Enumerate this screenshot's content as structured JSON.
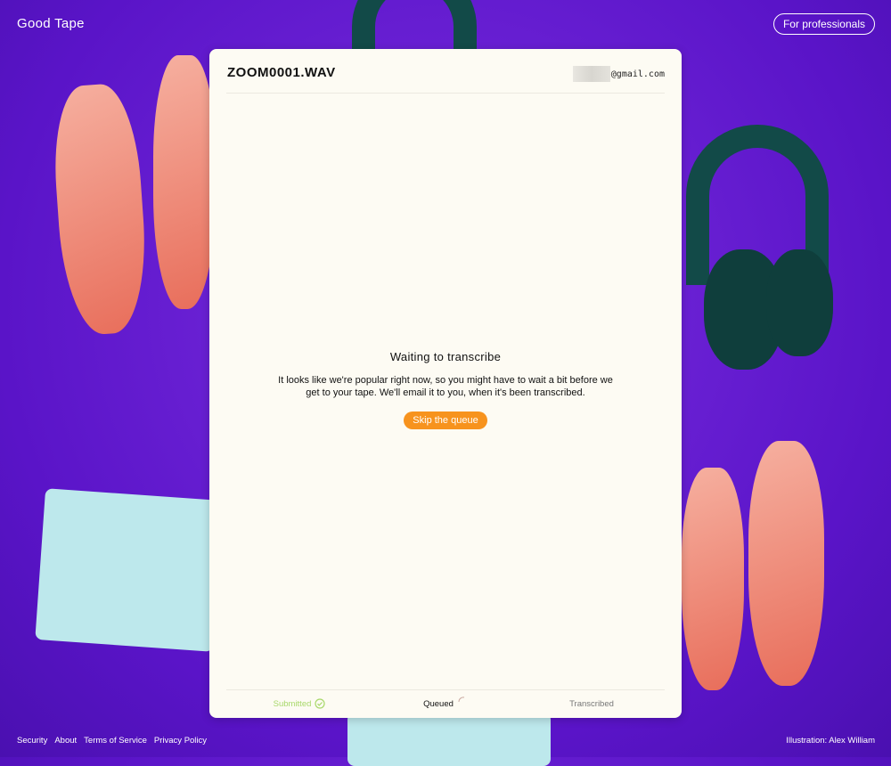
{
  "header": {
    "logo": "Good Tape",
    "pro_button": "For professionals"
  },
  "card": {
    "title": "ZOOM0001.WAV",
    "email_suffix": "@gmail.com",
    "status_title": "Waiting to transcribe",
    "status_message": "It looks like we're popular right now, so you might have to wait a bit before we get to your tape. We'll email it to you, when it's been transcribed.",
    "skip_button": "Skip the queue",
    "steps": [
      {
        "label": "Submitted",
        "state": "done"
      },
      {
        "label": "Queued",
        "state": "active"
      },
      {
        "label": "Transcribed",
        "state": "pending"
      }
    ]
  },
  "footer": {
    "links": [
      "Security",
      "About",
      "Terms of Service",
      "Privacy Policy"
    ],
    "credit": "Illustration: Alex William"
  },
  "colors": {
    "accent": "#f7931e",
    "done": "#a8d86a",
    "card": "#fdfbf3"
  }
}
